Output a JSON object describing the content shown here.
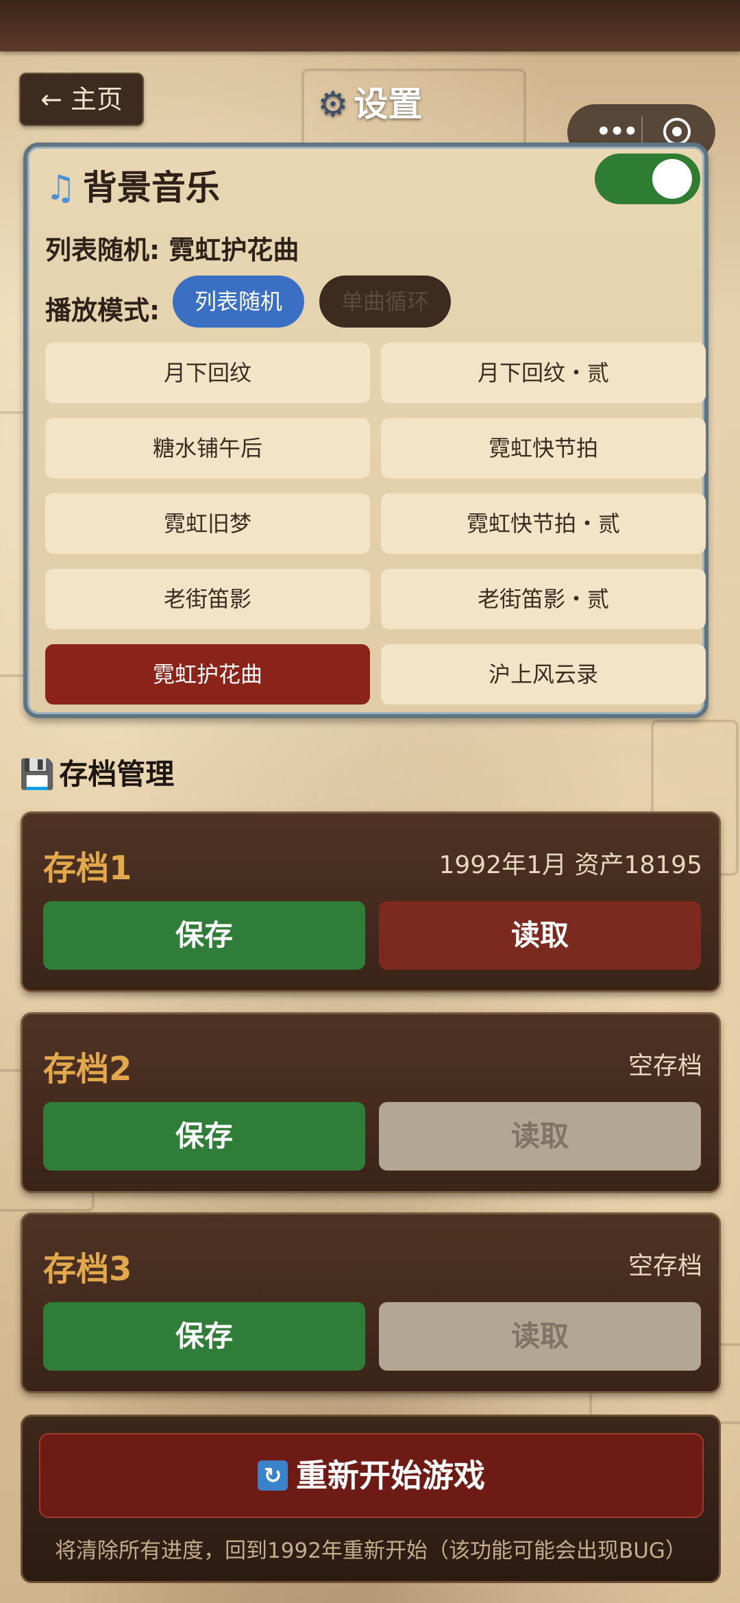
{
  "nav": {
    "home_label": "← 主页"
  },
  "page": {
    "title": "设置",
    "title_icon": "gear-icon"
  },
  "capsule": {
    "more_icon": "more-icon",
    "close_icon": "target-icon"
  },
  "music": {
    "title": "背景音乐",
    "title_icon": "music-note-icon",
    "enabled": true,
    "current_track": "列表随机: 霓虹护花曲",
    "mode_label": "播放模式:",
    "modes": [
      {
        "label": "列表随机",
        "active": true
      },
      {
        "label": "单曲循环",
        "active": false
      }
    ],
    "tracks": [
      {
        "label": "月下回纹"
      },
      {
        "label": "月下回纹・贰"
      },
      {
        "label": "糖水铺午后"
      },
      {
        "label": "霓虹快节拍"
      },
      {
        "label": "霓虹旧梦"
      },
      {
        "label": "霓虹快节拍・贰"
      },
      {
        "label": "老街笛影"
      },
      {
        "label": "老街笛影・贰"
      },
      {
        "label": "霓虹护花曲"
      },
      {
        "label": "沪上风云录"
      }
    ],
    "active_track_index": 8
  },
  "saves": {
    "title": "存档管理",
    "title_icon": "floppy-disk-icon",
    "slots": [
      {
        "name": "存档1",
        "info": "1992年1月 资产18195",
        "save_label": "保存",
        "load_label": "读取",
        "load_enabled": true
      },
      {
        "name": "存档2",
        "info": "空存档",
        "save_label": "保存",
        "load_label": "读取",
        "load_enabled": false
      },
      {
        "name": "存档3",
        "info": "空存档",
        "save_label": "保存",
        "load_label": "读取",
        "load_enabled": false
      }
    ]
  },
  "restart": {
    "label": "重新开始游戏",
    "icon": "refresh-icon",
    "note": "将清除所有进度，回到1992年重新开始（该功能可能会出现BUG）"
  },
  "colors": {
    "accent_blue": "#3a6fc4",
    "active_track": "#8a2418",
    "save_green": "#2f7d38",
    "load_red": "#7c2a20",
    "slot_name_gold": "#e1a94c"
  }
}
